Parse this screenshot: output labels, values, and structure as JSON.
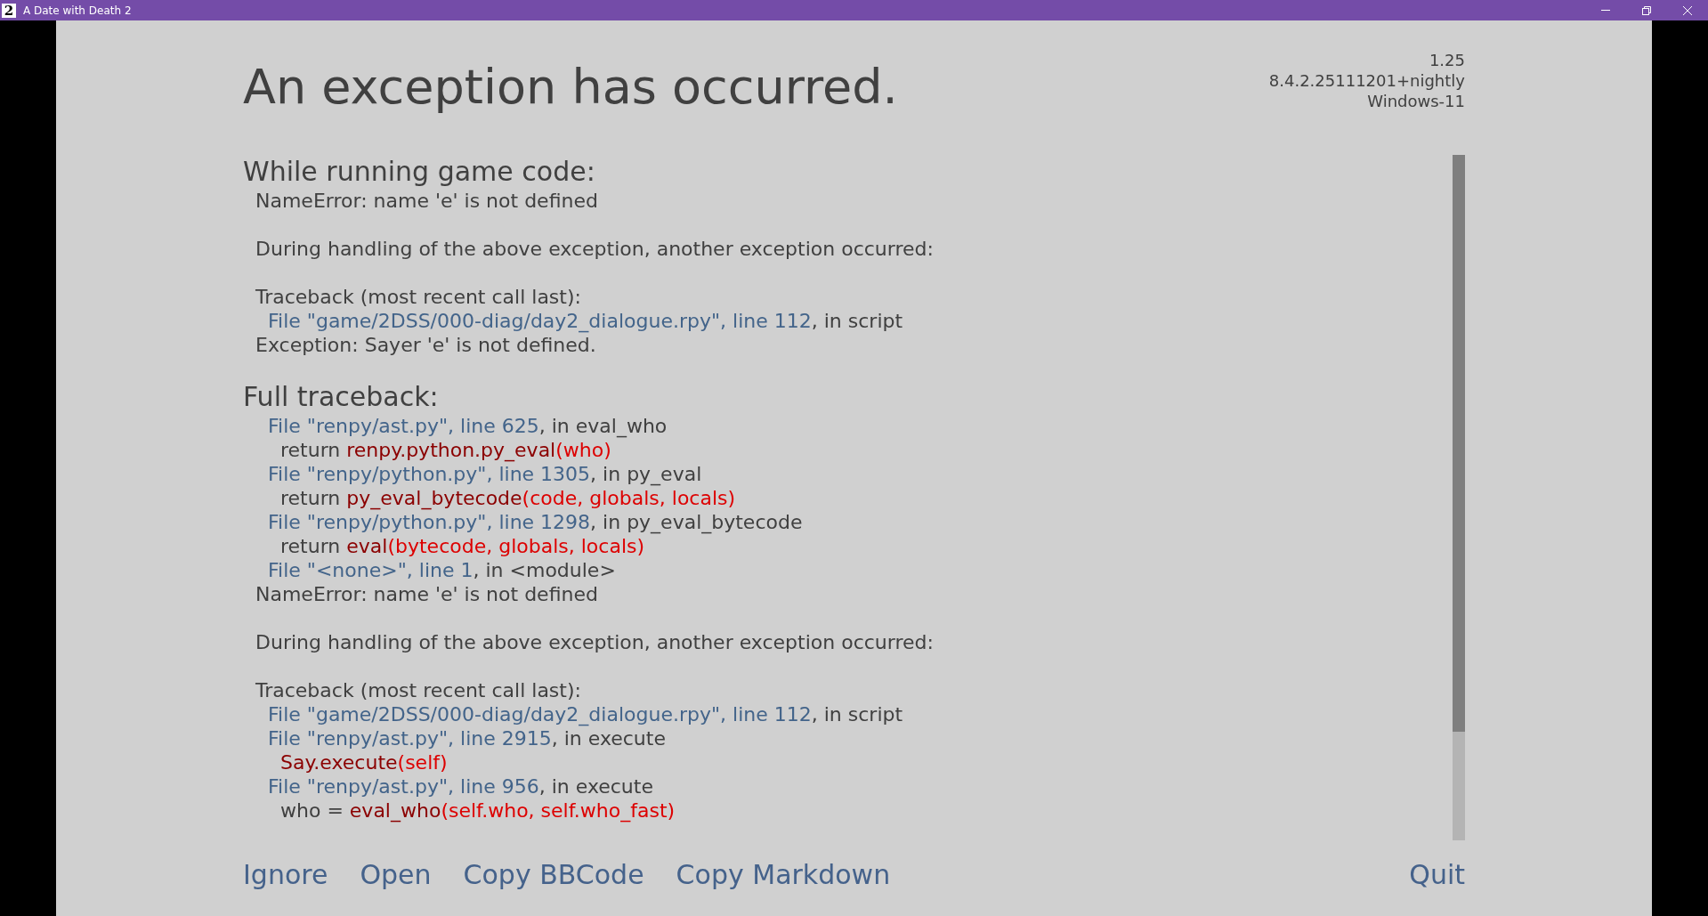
{
  "window": {
    "title": "A Date with Death 2",
    "icon_glyph": "2"
  },
  "heading": "An exception has occurred.",
  "version_info": [
    "1.25",
    "8.4.2.25111201+nightly",
    "Windows-11"
  ],
  "sections": [
    {
      "title": "While running game code:",
      "lines": [
        {
          "kind": "message",
          "parts": [
            {
              "kind": "plain",
              "text": "NameError: name 'e' is not defined"
            }
          ]
        },
        {
          "kind": "blank"
        },
        {
          "kind": "message",
          "parts": [
            {
              "kind": "plain",
              "text": "During handling of the above exception, another exception occurred:"
            }
          ]
        },
        {
          "kind": "blank"
        },
        {
          "kind": "message",
          "parts": [
            {
              "kind": "plain",
              "text": "Traceback (most recent call last):"
            }
          ]
        },
        {
          "kind": "file",
          "parts": [
            {
              "kind": "link",
              "text": "File \"game/2DSS/000-diag/day2_dialogue.rpy\", line 112"
            },
            {
              "kind": "plain",
              "text": ", in script"
            }
          ]
        },
        {
          "kind": "message",
          "parts": [
            {
              "kind": "plain",
              "text": "Exception: Sayer 'e' is not defined."
            }
          ]
        }
      ]
    },
    {
      "title": "Full traceback:",
      "lines": [
        {
          "kind": "file",
          "parts": [
            {
              "kind": "link",
              "text": "File \"renpy/ast.py\", line 625"
            },
            {
              "kind": "plain",
              "text": ", in eval_who"
            }
          ]
        },
        {
          "kind": "code",
          "parts": [
            {
              "kind": "plain",
              "text": "return "
            },
            {
              "kind": "callee",
              "text": "renpy.python.py_eval"
            },
            {
              "kind": "args",
              "text": "(who)"
            }
          ]
        },
        {
          "kind": "file",
          "parts": [
            {
              "kind": "link",
              "text": "File \"renpy/python.py\", line 1305"
            },
            {
              "kind": "plain",
              "text": ", in py_eval"
            }
          ]
        },
        {
          "kind": "code",
          "parts": [
            {
              "kind": "plain",
              "text": "return "
            },
            {
              "kind": "callee",
              "text": "py_eval_bytecode"
            },
            {
              "kind": "args",
              "text": "(code, globals, locals)"
            }
          ]
        },
        {
          "kind": "file",
          "parts": [
            {
              "kind": "link",
              "text": "File \"renpy/python.py\", line 1298"
            },
            {
              "kind": "plain",
              "text": ", in py_eval_bytecode"
            }
          ]
        },
        {
          "kind": "code",
          "parts": [
            {
              "kind": "plain",
              "text": "return "
            },
            {
              "kind": "callee",
              "text": "eval"
            },
            {
              "kind": "args",
              "text": "(bytecode, globals, locals)"
            }
          ]
        },
        {
          "kind": "file",
          "parts": [
            {
              "kind": "link",
              "text": "File \"<none>\", line 1"
            },
            {
              "kind": "plain",
              "text": ", in <module>"
            }
          ]
        },
        {
          "kind": "message",
          "parts": [
            {
              "kind": "plain",
              "text": "NameError: name 'e' is not defined"
            }
          ]
        },
        {
          "kind": "blank"
        },
        {
          "kind": "message",
          "parts": [
            {
              "kind": "plain",
              "text": "During handling of the above exception, another exception occurred:"
            }
          ]
        },
        {
          "kind": "blank"
        },
        {
          "kind": "message",
          "parts": [
            {
              "kind": "plain",
              "text": "Traceback (most recent call last):"
            }
          ]
        },
        {
          "kind": "file",
          "parts": [
            {
              "kind": "link",
              "text": "File \"game/2DSS/000-diag/day2_dialogue.rpy\", line 112"
            },
            {
              "kind": "plain",
              "text": ", in script"
            }
          ]
        },
        {
          "kind": "file",
          "parts": [
            {
              "kind": "link",
              "text": "File \"renpy/ast.py\", line 2915"
            },
            {
              "kind": "plain",
              "text": ", in execute"
            }
          ]
        },
        {
          "kind": "code",
          "parts": [
            {
              "kind": "callee",
              "text": "Say.execute"
            },
            {
              "kind": "args",
              "text": "(self)"
            }
          ]
        },
        {
          "kind": "file",
          "parts": [
            {
              "kind": "link",
              "text": "File \"renpy/ast.py\", line 956"
            },
            {
              "kind": "plain",
              "text": ", in execute"
            }
          ]
        },
        {
          "kind": "code",
          "parts": [
            {
              "kind": "plain",
              "text": "who = "
            },
            {
              "kind": "callee",
              "text": "eval_who"
            },
            {
              "kind": "args",
              "text": "(self.who, self.who_fast)"
            }
          ]
        }
      ]
    }
  ],
  "actions": [
    "Ignore",
    "Open",
    "Copy BBCode",
    "Copy Markdown",
    "Quit"
  ]
}
